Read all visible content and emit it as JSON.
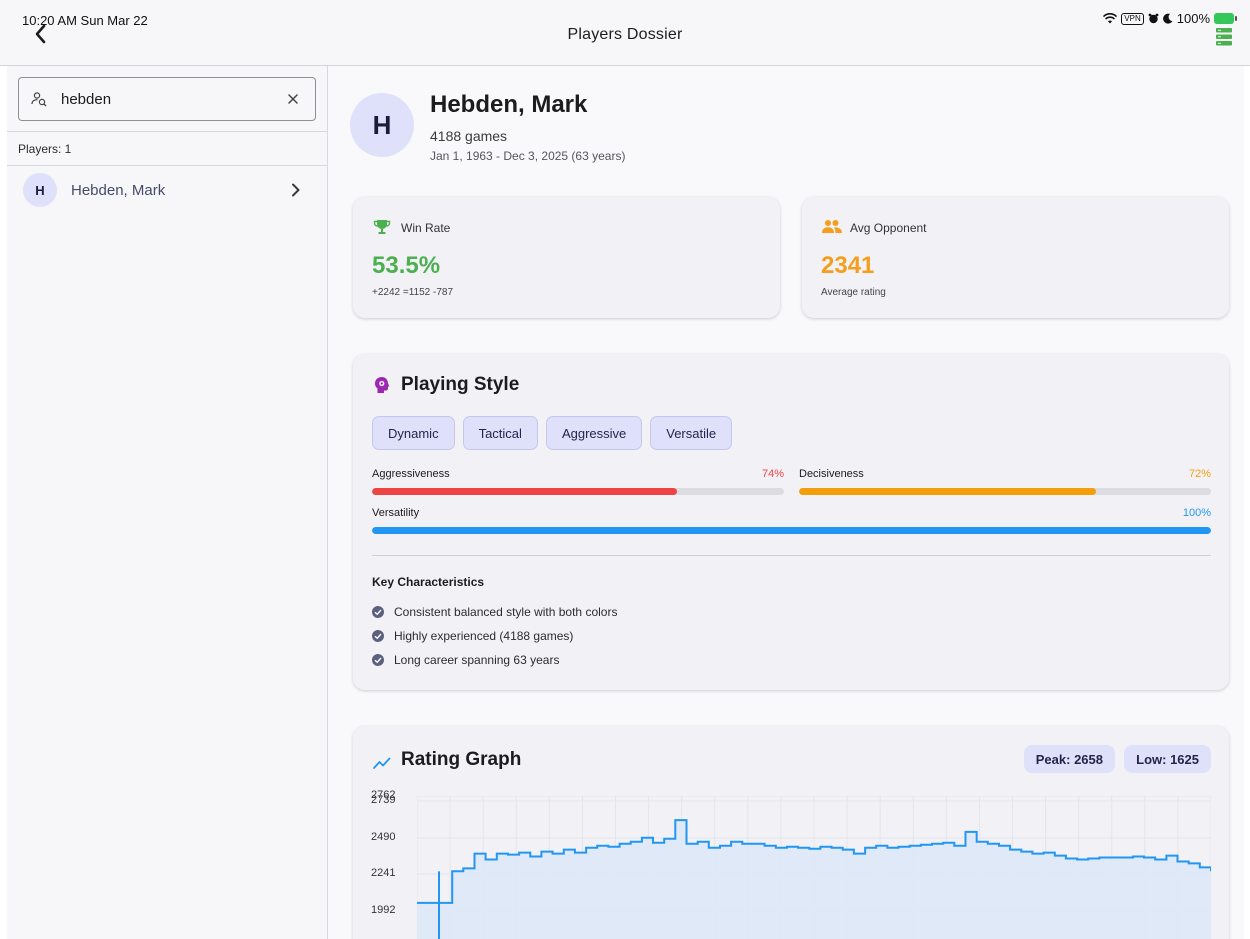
{
  "status_bar": {
    "time": "10:20 AM  Sun Mar 22",
    "vpn": "VPN",
    "battery": "100%"
  },
  "nav": {
    "title": "Players Dossier"
  },
  "sidebar": {
    "search_value": "hebden",
    "players_count": "Players: 1",
    "players": [
      {
        "initial": "H",
        "name": "Hebden, Mark"
      }
    ]
  },
  "player": {
    "initial": "H",
    "name": "Hebden, Mark",
    "games": "4188 games",
    "dates": "Jan 1, 1963 - Dec 3, 2025 (63 years)"
  },
  "stats": {
    "win_rate": {
      "label": "Win Rate",
      "value": "53.5%",
      "sub": "+2242 =1152 -787",
      "color": "#4caf50"
    },
    "avg_opponent": {
      "label": "Avg Opponent",
      "value": "2341",
      "sub": "Average rating",
      "color": "#f59e1b"
    }
  },
  "playing_style": {
    "title": "Playing Style",
    "tags": [
      "Dynamic",
      "Tactical",
      "Aggressive",
      "Versatile"
    ],
    "metrics": [
      {
        "label": "Aggressiveness",
        "value_text": "74%",
        "value": 74,
        "color": "#ef4444"
      },
      {
        "label": "Decisiveness",
        "value_text": "72%",
        "value": 72,
        "color": "#f59e0b"
      },
      {
        "label": "Versatility",
        "value_text": "100%",
        "value": 100,
        "color": "#2196f3"
      }
    ],
    "key_title": "Key Characteristics",
    "key_items": [
      "Consistent balanced style with both colors",
      "Highly experienced (4188 games)",
      "Long career spanning 63 years"
    ]
  },
  "rating_graph": {
    "title": "Rating Graph",
    "peak": "Peak: 2658",
    "low": "Low: 1625"
  },
  "chart_data": {
    "type": "line",
    "title": "Rating Graph",
    "y_ticks_visible": [
      "2762",
      "2739",
      "2490",
      "2241",
      "1992"
    ],
    "y_range_visible": [
      1900,
      2762
    ],
    "line_color": "#2196f3",
    "fill_color": "#dde8f7",
    "series": [
      {
        "values": [
          2220,
          2380,
          2395,
          2470,
          2440,
          2470,
          2465,
          2475,
          2455,
          2480,
          2470,
          2490,
          2475,
          2500,
          2510,
          2505,
          2520,
          2530,
          2550,
          2525,
          2545,
          2640,
          2520,
          2530,
          2500,
          2510,
          2530,
          2520,
          2520,
          2510,
          2500,
          2505,
          2500,
          2495,
          2505,
          2500,
          2490,
          2470,
          2500,
          2510,
          2500,
          2505,
          2510,
          2515,
          2520,
          2525,
          2510,
          2580,
          2530,
          2520,
          2510,
          2490,
          2480,
          2470,
          2475,
          2460,
          2445,
          2440,
          2445,
          2450,
          2450,
          2450,
          2455,
          2450,
          2440,
          2460,
          2430,
          2420,
          2400,
          2380
        ]
      }
    ]
  }
}
